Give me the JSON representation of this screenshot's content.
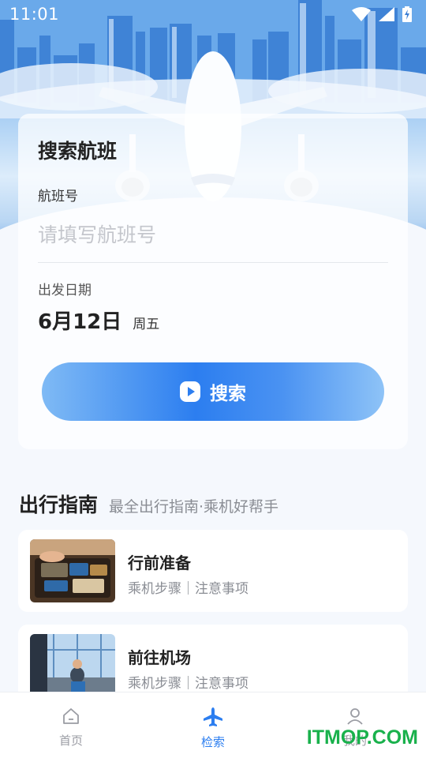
{
  "status_bar": {
    "time": "11:01",
    "icons": [
      "wifi-icon",
      "signal-icon",
      "battery-charging-icon"
    ]
  },
  "search_card": {
    "title": "搜索航班",
    "flight_label": "航班号",
    "flight_placeholder": "请填写航班号",
    "flight_value": "",
    "date_label": "出发日期",
    "date_value": "6月12日",
    "date_weekday": "周五",
    "search_button_label": "搜索"
  },
  "guide": {
    "title": "出行指南",
    "subtitle": "最全出行指南·乘机好帮手",
    "items": [
      {
        "title": "行前准备",
        "desc": "乘机步骤｜注意事项",
        "thumb": "luggage-photo"
      },
      {
        "title": "前往机场",
        "desc": "乘机步骤｜注意事项",
        "thumb": "airport-photo"
      }
    ]
  },
  "bottom_nav": {
    "items": [
      {
        "label": "首页",
        "icon": "home-icon",
        "active": false
      },
      {
        "label": "检索",
        "icon": "airplane-icon",
        "active": true
      },
      {
        "label": "我的",
        "icon": "user-icon",
        "active": false
      }
    ]
  },
  "watermark": "ITMOP.COM",
  "colors": {
    "accent": "#2c7ef0",
    "background": "#f5f8fd",
    "watermark": "#19b14c"
  }
}
